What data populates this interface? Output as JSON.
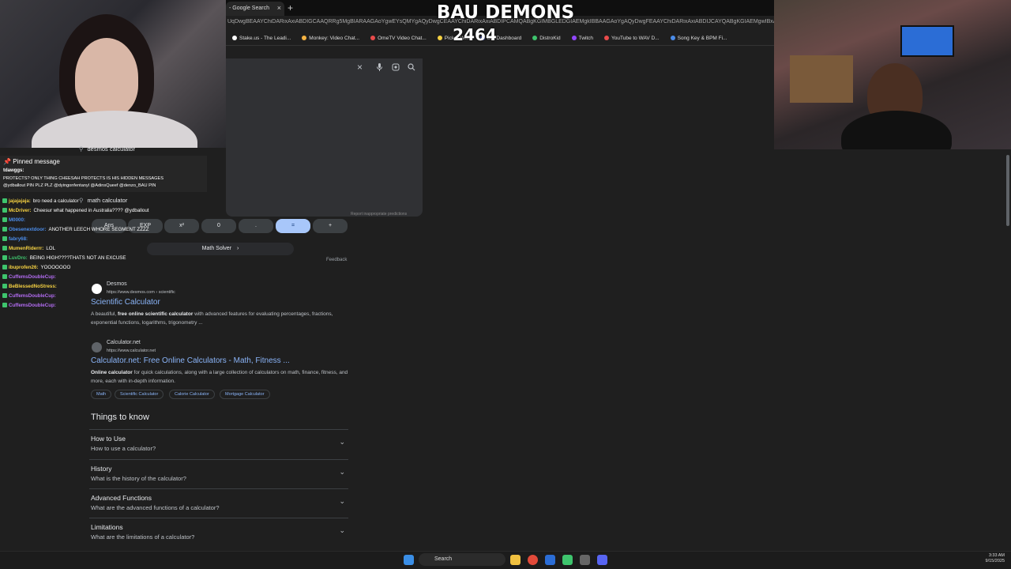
{
  "overlay": {
    "title": "BAU DEMONS",
    "count": "2464"
  },
  "browser": {
    "tab_title": "- Google Search",
    "tab_close": "×",
    "new_tab": "+",
    "url_fragment": "UqDwgBEAAYChiDARixAxiABDIGCAAQRRg5MgBIARAAGAoYgwEYsQMYgAQyDwgCEAAYChiDARixAxiABDIPCAMQABgKGIMBGLEDGIAEMgkIBBAAGAoYgAQyDwgFEAAYChiDARixAxiABDIJCAYQABgKGIAEMgwIBxAAGAoYsQMYgAQy",
    "bookmarks": [
      {
        "label": "Stake.us - The Leadi...",
        "color": "#ffffff"
      },
      {
        "label": "Monkey: Video Chat...",
        "color": "#f5b342"
      },
      {
        "label": "OmeTV Video Chat...",
        "color": "#e94b4b"
      },
      {
        "label": "Picker W...",
        "color": "#f5d142"
      },
      {
        "label": "Bot Dashboard",
        "color": "#6a7cf2"
      },
      {
        "label": "DistroKid",
        "color": "#3ec46d"
      },
      {
        "label": "Twitch",
        "color": "#9147ff"
      },
      {
        "label": "YouTube to WAV D...",
        "color": "#e94b4b"
      },
      {
        "label": "Song Key & BPM Fi...",
        "color": "#4b8ce9"
      }
    ]
  },
  "search": {
    "clear_icon": "×",
    "mic_icon": "mic-icon",
    "lens_icon": "lens-icon",
    "search_icon": "search-icon",
    "suggestions": [
      "desmos calculator",
      "math calculator"
    ],
    "report_link": "Report inappropriate predictions"
  },
  "calculator": {
    "keys": [
      "Ans",
      "EXP",
      "x²",
      "0",
      ".",
      "=",
      "+"
    ],
    "math_solver": "Math Solver",
    "math_solver_chevron": "›",
    "feedback": "Feedback"
  },
  "results": [
    {
      "site": "Desmos",
      "url": "https://www.desmos.com › scientific",
      "title": "Scientific Calculator",
      "snippet_bold": "free online scientific calculator",
      "snippet_pre": "A beautiful, ",
      "snippet_post": " with advanced features for evaluating percentages, fractions, exponential functions, logarithms, trigonometry ..."
    },
    {
      "site": "Calculator.net",
      "url": "https://www.calculator.net",
      "title": "Calculator.net: Free Online Calculators - Math, Fitness ...",
      "snippet_bold": "Online calculator",
      "snippet_pre": "",
      "snippet_post": " for quick calculations, along with a large collection of calculators on math, finance, fitness, and more, each with in-depth information.",
      "chips": [
        "Math",
        "Scientific Calculator",
        "Calorie Calculator",
        "Mortgage Calculator"
      ]
    }
  ],
  "things_to_know": {
    "heading": "Things to know",
    "items": [
      {
        "title": "How to Use",
        "sub": "How to use a calculator?"
      },
      {
        "title": "History",
        "sub": "What is the history of the calculator?"
      },
      {
        "title": "Advanced Functions",
        "sub": "What are the advanced functions of a calculator?"
      },
      {
        "title": "Limitations",
        "sub": "What are the limitations of a calculator?"
      }
    ]
  },
  "chat": {
    "pinned_label": "Pinned message",
    "pinned_user": "tdawggs:",
    "pinned_text_1": "PROTECTS? ONLY THING CHEESAH PROTECTS IS HIS HIDDEN MESSAGES",
    "pinned_text_2": "@ydballout PIN PLZ PLZ @dyingonfentanyl @AdinsQueef @denzo_BAU PIN",
    "lines": [
      {
        "user": "jajajajaja:",
        "text": "bro need a calculator",
        "color": "#f5d142"
      },
      {
        "user": "McDriver:",
        "text": "Cheesur what happened in Australia????  @ydballout",
        "color": "#f5d142"
      },
      {
        "user": "M0000:",
        "text": "",
        "color": "#4b8ce9"
      },
      {
        "user": "Obesenextdoor:",
        "text": "ANOTHER LEECH WHORE SEGMENT ZZZZ",
        "color": "#4b8ce9"
      },
      {
        "user": "fabry68:",
        "text": "",
        "color": "#4b8ce9"
      },
      {
        "user": "MumenRiderrr:",
        "text": "LOL",
        "color": "#f5d142"
      },
      {
        "user": "LuvDro:",
        "text": "BEING HIGH????THATS NOT AN EXCUSE",
        "color": "#3ec46d"
      },
      {
        "user": "ibuprofen26:",
        "text": "YOOOOOOO",
        "color": "#f5d142"
      },
      {
        "user": "CuffemsDoubleCup:",
        "text": "",
        "color": "#b36cf2"
      },
      {
        "user": "BeBlessedNoStress:",
        "text": "",
        "color": "#f5d142"
      },
      {
        "user": "CuffemsDoubleCup:",
        "text": "",
        "color": "#b36cf2"
      },
      {
        "user": "CuffemsDoubleCup:",
        "text": "",
        "color": "#b36cf2"
      }
    ]
  },
  "taskbar": {
    "search_label": "Search",
    "time": "3:33 AM",
    "date": "9/15/2025"
  }
}
